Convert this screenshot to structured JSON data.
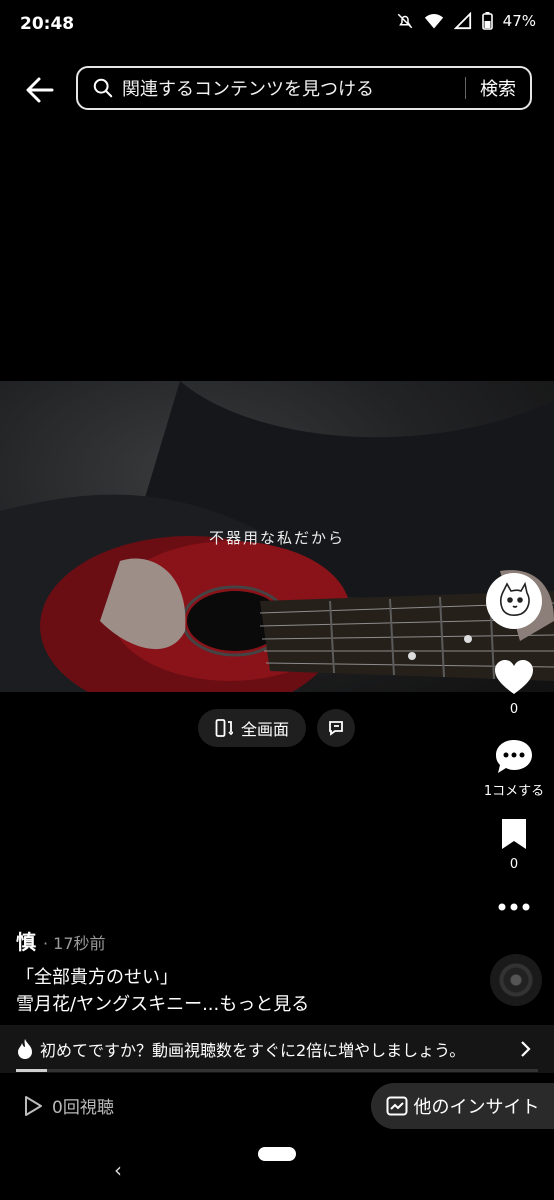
{
  "status": {
    "time": "20:48",
    "battery": "47%"
  },
  "header": {
    "search_placeholder": "関連するコンテンツを見つける",
    "search_button": "検索"
  },
  "video": {
    "subtitle": "不器用な私だから",
    "fullscreen_label": "全画面"
  },
  "rail": {
    "likes": "0",
    "comments": "1コメする",
    "saves": "0"
  },
  "post": {
    "author": "慎",
    "time": "· 17秒前",
    "caption_line1": "「全部貴方のせい」",
    "caption_line2": "雪月花/ヤングスキニー...もっと見る"
  },
  "promo": {
    "text": "初めてですか？動画視聴数をすぐに2倍に増やしましょう。",
    "progress_fraction": 0.06
  },
  "footer": {
    "views": "0回視聴",
    "insight_button": "他のインサイト"
  }
}
